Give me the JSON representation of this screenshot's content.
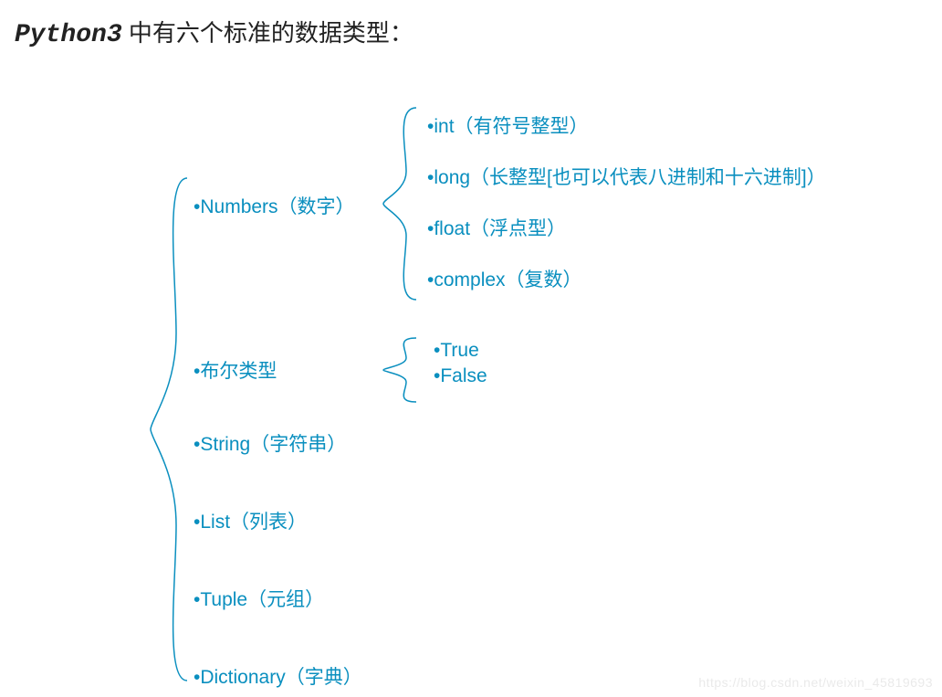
{
  "title": {
    "prefix": "Python3",
    "rest": " 中有六个标准的数据类型："
  },
  "main": [
    "•Numbers（数字）",
    "•布尔类型",
    "•String（字符串）",
    "•List（列表）",
    "•Tuple（元组）",
    "•Dictionary（字典）"
  ],
  "numbers_sub": [
    "•int（有符号整型）",
    "•long（长整型[也可以代表八进制和十六进制]）",
    "•float（浮点型）",
    "•complex（复数）"
  ],
  "bool_sub": [
    "•True",
    "•False"
  ],
  "watermark": "https://blog.csdn.net/weixin_45819693"
}
